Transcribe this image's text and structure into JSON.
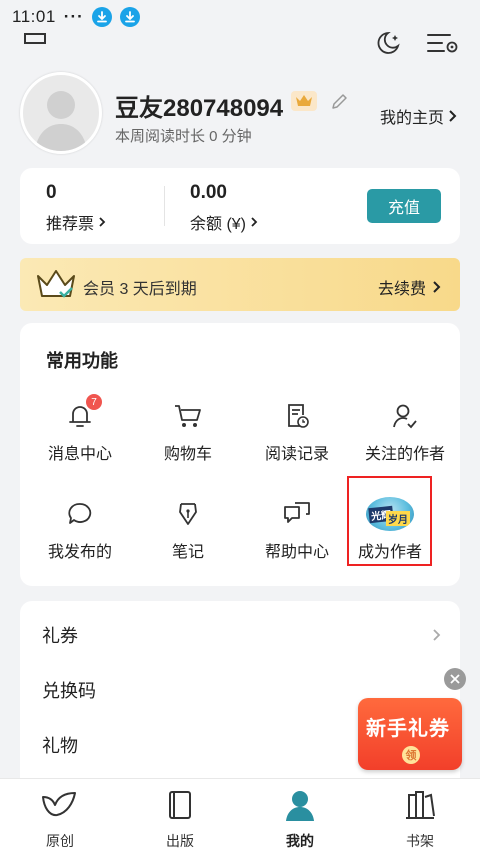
{
  "status_bar": {
    "time": "11:01",
    "dots": "···"
  },
  "profile": {
    "username": "豆友280748094",
    "read_time": "本周阅读时长 0 分钟",
    "homepage_link": "我的主页"
  },
  "wallet": {
    "tickets_value": "0",
    "tickets_label": "推荐票",
    "balance_value": "0.00",
    "balance_label": "余额 (¥)",
    "recharge_label": "充值"
  },
  "vip": {
    "message": "会员 3 天后到期",
    "renew_label": "去续费"
  },
  "features": {
    "title": "常用功能",
    "items": [
      {
        "label": "消息中心",
        "icon": "bell-icon",
        "badge": "7"
      },
      {
        "label": "购物车",
        "icon": "cart-icon"
      },
      {
        "label": "阅读记录",
        "icon": "history-icon"
      },
      {
        "label": "关注的作者",
        "icon": "followed-author-icon"
      },
      {
        "label": "我发布的",
        "icon": "comment-icon"
      },
      {
        "label": "笔记",
        "icon": "pen-nib-icon"
      },
      {
        "label": "帮助中心",
        "icon": "help-icon"
      },
      {
        "label": "成为作者",
        "icon": "become-author-image",
        "image_text": [
          "光辉",
          "岁月"
        ]
      }
    ]
  },
  "list": {
    "items": [
      "礼券",
      "兑换码",
      "礼物"
    ]
  },
  "promo": {
    "text": "新手礼券",
    "get_label": "领"
  },
  "tabs": [
    {
      "label": "原创",
      "icon": "bird-icon"
    },
    {
      "label": "出版",
      "icon": "book-icon"
    },
    {
      "label": "我的",
      "icon": "user-icon",
      "active": true
    },
    {
      "label": "书架",
      "icon": "bookshelf-icon"
    }
  ],
  "colors": {
    "accent": "#2a9aa5",
    "badge": "#f0554f",
    "vip_bg": "#f8d98a",
    "highlight_border": "#e22222"
  }
}
